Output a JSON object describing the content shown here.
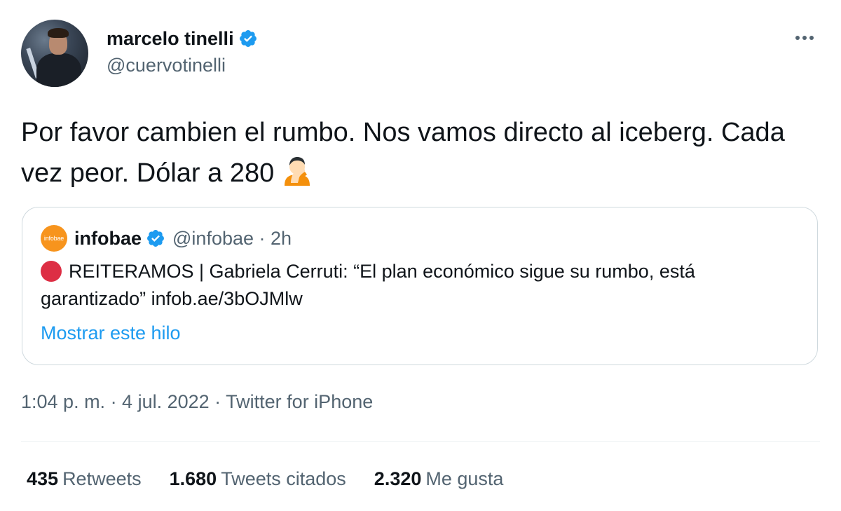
{
  "author": {
    "name": "marcelo tinelli",
    "handle": "@cuervotinelli"
  },
  "tweet": {
    "text": "Por favor cambien el rumbo. Nos vamos directo al iceberg. Cada vez peor. Dólar a 280",
    "emoji": "facepalm-emoji"
  },
  "quote": {
    "logo_text": "infobae",
    "name": "infobae",
    "handle_time": "@infobae · 2h",
    "text": "REITERAMOS | Gabriela Cerruti: “El plan económico sigue su rumbo, está garantizado” infob.ae/3bOJMlw",
    "link": "Mostrar este hilo"
  },
  "meta": "1:04 p. m. · 4 jul. 2022 · Twitter for iPhone",
  "stats": [
    {
      "num": "435",
      "label": "Retweets"
    },
    {
      "num": "1.680",
      "label": "Tweets citados"
    },
    {
      "num": "2.320",
      "label": "Me gusta"
    }
  ],
  "colors": {
    "accent": "#1d9bf0",
    "secondary_text": "#536471",
    "border": "#cfd9de",
    "infobae_orange": "#f7941d",
    "red_circle": "#dd2e44"
  }
}
